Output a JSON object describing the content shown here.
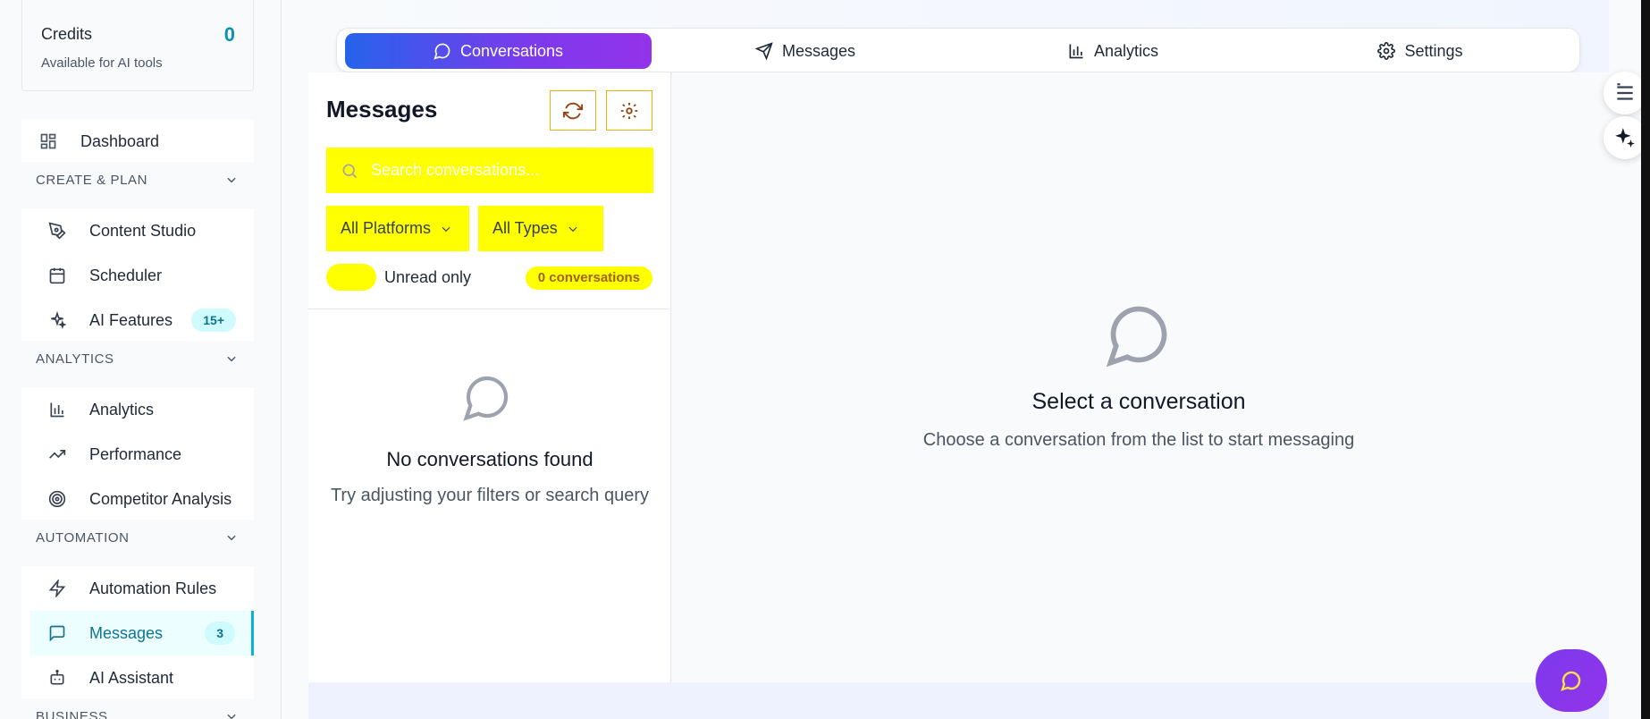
{
  "credits": {
    "title": "Credits",
    "value": "0",
    "subtitle": "Available for AI tools"
  },
  "sidebar": {
    "dashboard": "Dashboard",
    "sections": {
      "create": "CREATE & PLAN",
      "analytics": "ANALYTICS",
      "automation": "AUTOMATION",
      "business": "BUSINESS"
    },
    "create_items": [
      "Content Studio",
      "Scheduler",
      "AI Features"
    ],
    "ai_features_badge": "15+",
    "analytics_items": [
      "Analytics",
      "Performance",
      "Competitor Analysis"
    ],
    "automation_items": [
      "Automation Rules",
      "Messages",
      "AI Assistant"
    ],
    "messages_badge": "3"
  },
  "tabs": [
    "Conversations",
    "Messages",
    "Analytics",
    "Settings"
  ],
  "panel": {
    "title": "Messages",
    "search_placeholder": "Search conversations...",
    "platform_filter": "All Platforms",
    "type_filter": "All Types",
    "unread_label": "Unread only",
    "count_label": "0 conversations",
    "empty_title": "No conversations found",
    "empty_sub": "Try adjusting your filters or search query"
  },
  "conversation": {
    "title": "Select a conversation",
    "subtitle": "Choose a conversation from the list to start messaging"
  },
  "colors": {
    "accent": "#06b6d4",
    "highlight": "#ffff00",
    "gradient_start": "#2563eb",
    "gradient_end": "#9333ea"
  }
}
